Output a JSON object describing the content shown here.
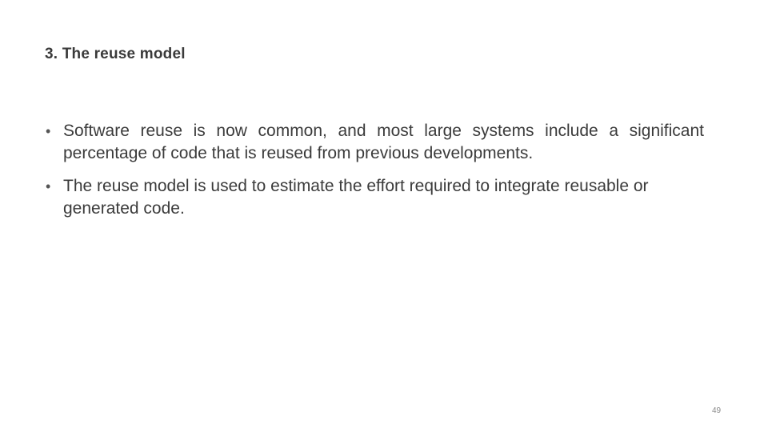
{
  "slide": {
    "title": "3. The reuse model",
    "bullet_glyph": "•",
    "bullets": [
      {
        "text": "Software reuse is now common, and most large systems include a significant percentage of code that is reused from previous developments."
      },
      {
        "text": "The reuse model is used to estimate the effort required to integrate reusable or generated code."
      }
    ],
    "page_number": "49"
  }
}
